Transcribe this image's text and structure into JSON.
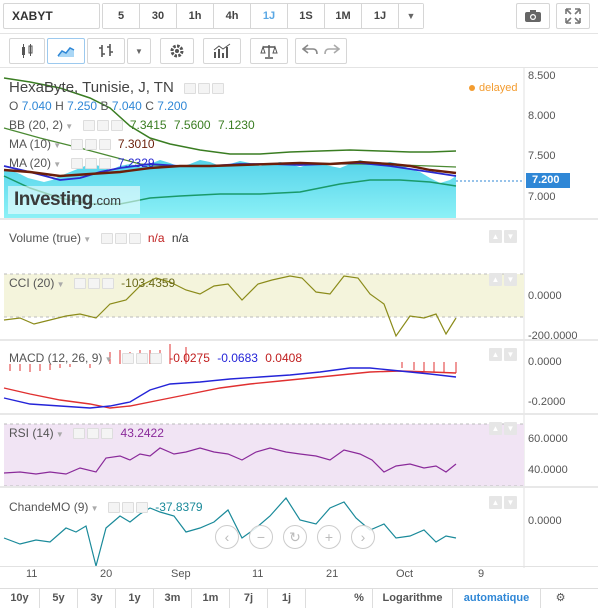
{
  "toolbar": {
    "symbol": "XABYT",
    "timeframes": [
      "5",
      "30",
      "1h",
      "4h",
      "1J",
      "1S",
      "1M",
      "1J"
    ],
    "active_timeframe_index": 4,
    "dropdown_glyph": "▼"
  },
  "legend": {
    "title": "HexaByte, Tunisie, J, TN",
    "status": "delayed",
    "ohlc": {
      "o_label": "O",
      "o": "7.040",
      "h_label": "H",
      "h": "7.250",
      "b_label": "B",
      "b": "7.040",
      "c_label": "C",
      "c": "7.200"
    },
    "bb": {
      "label": "BB (20, 2)",
      "v1": "7.3415",
      "v2": "7.5600",
      "v3": "7.1230"
    },
    "ma10": {
      "label": "MA (10)",
      "v": "7.3010"
    },
    "ma20": {
      "label": "MA (20)",
      "v": "7.2329"
    },
    "logo_text": "Investing",
    "logo_suffix": ".com"
  },
  "price_axis": [
    "8.500",
    "8.000",
    "7.500",
    "7.000"
  ],
  "last_price": "7.200",
  "volume": {
    "label": "Volume (true)",
    "v1": "n/a",
    "v2": "n/a"
  },
  "cci": {
    "label": "CCI (20)",
    "v": "-103.4359",
    "axis": [
      "0.0000",
      "-200.0000"
    ]
  },
  "macd": {
    "label": "MACD (12, 26, 9)",
    "v1": "-0.0275",
    "v2": "-0.0683",
    "v3": "0.0408",
    "axis": [
      "0.0000",
      "-0.2000"
    ]
  },
  "rsi": {
    "label": "RSI (14)",
    "v": "43.2422",
    "axis": [
      "60.0000",
      "40.0000"
    ]
  },
  "chandemo": {
    "label": "ChandeMO (9)",
    "v": "-37.8379",
    "axis": [
      "0.0000"
    ]
  },
  "dates": [
    "11",
    "20",
    "Sep",
    "11",
    "21",
    "Oct",
    "9"
  ],
  "ranges": [
    "10y",
    "5y",
    "3y",
    "1y",
    "3m",
    "1m",
    "7j",
    "1j"
  ],
  "bottom": {
    "percent": "%",
    "log": "Logarithme",
    "auto": "automatique"
  },
  "colors": {
    "accent": "#2f87d6",
    "bb_line": "#3a7d22",
    "ma10": "#6b1f0a",
    "ma20": "#2a2ad0",
    "area_top": "#4fd6e6",
    "area_bottom": "#8ef0f6",
    "cci_line": "#8b8b1a",
    "cci_band": "#f4f4dc",
    "macd_line": "#2424d8",
    "macd_signal": "#e03030",
    "rsi_line": "#8a2a9a",
    "rsi_band": "#f1e4f4",
    "cmo_line": "#1a8a9a",
    "delayed": "#f39c30"
  }
}
